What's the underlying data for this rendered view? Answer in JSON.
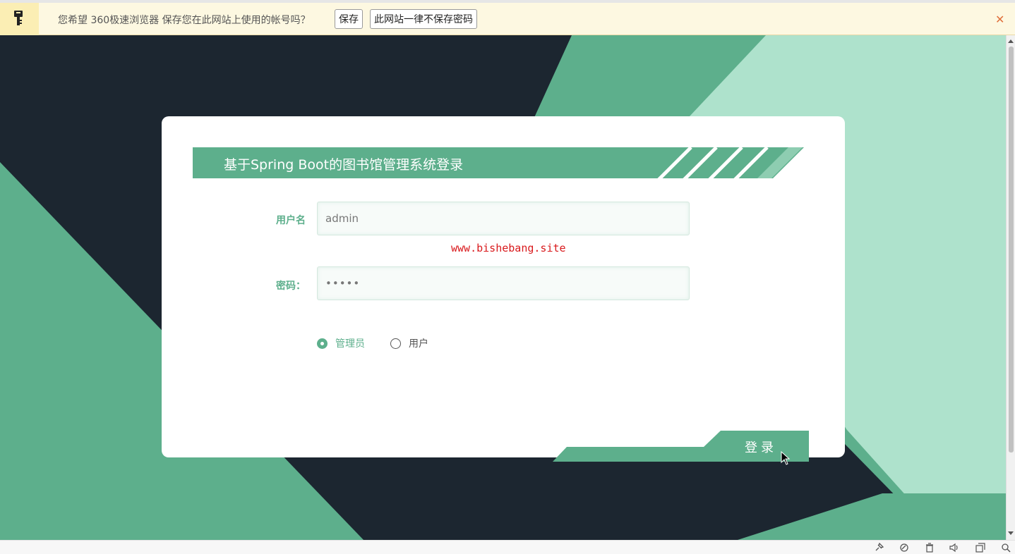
{
  "password_bar": {
    "message": "您希望 360极速浏览器 保存您在此网站上使用的帐号吗？",
    "save_label": "保存",
    "never_label": "此网站一律不保存密码",
    "close_label": "✕"
  },
  "login": {
    "title": "基于Spring Boot的图书馆管理系统登录",
    "username_label": "用户名",
    "username_value": "admin",
    "watermark": "www.bishebang.site",
    "password_label": "密码：",
    "password_value": "•••••",
    "roles": [
      {
        "label": "管理员",
        "checked": true
      },
      {
        "label": "用户",
        "checked": false
      }
    ],
    "login_button": "登录"
  },
  "colors": {
    "accent": "#5daf8c",
    "light_green": "#aee2cc",
    "dark_navy": "#1c2630",
    "watermark_red": "#d9191c"
  },
  "status_icons": [
    "pin-icon",
    "refresh-icon",
    "trash-icon",
    "volume-icon",
    "window-icon",
    "search-icon"
  ]
}
